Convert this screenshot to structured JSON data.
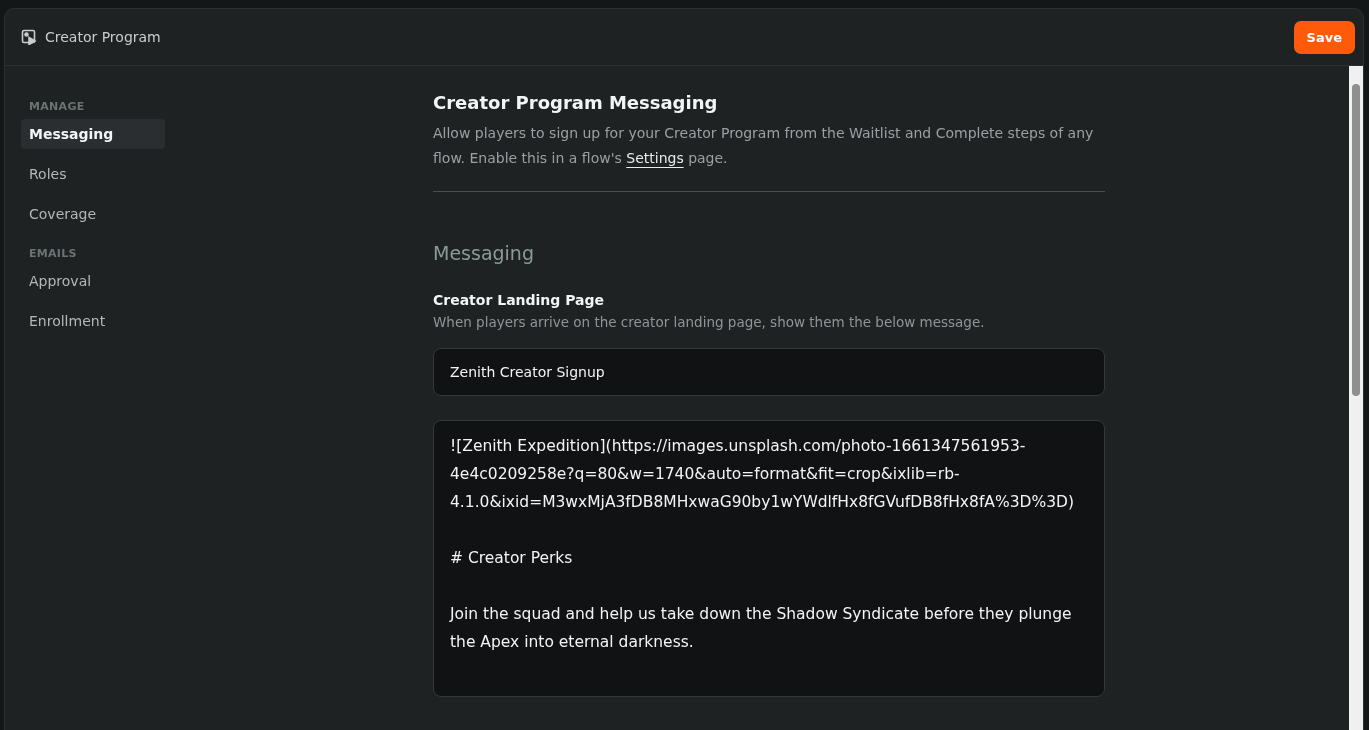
{
  "window": {
    "title": "Creator Program",
    "save_button": "Save"
  },
  "sidebar": {
    "sections": [
      {
        "heading": "MANAGE",
        "items": [
          {
            "label": "Messaging",
            "selected": true
          },
          {
            "label": "Roles",
            "selected": false
          },
          {
            "label": "Coverage",
            "selected": false
          }
        ]
      },
      {
        "heading": "EMAILS",
        "items": [
          {
            "label": "Approval",
            "selected": false
          },
          {
            "label": "Enrollment",
            "selected": false
          }
        ]
      }
    ]
  },
  "main": {
    "title": "Creator Program Messaging",
    "description_before": "Allow players to sign up for your Creator Program from the Waitlist and Complete steps of any flow. Enable this in a flow's",
    "description_link": "Settings",
    "description_after": "page.",
    "section_title": "Messaging",
    "field_label": "Creator Landing Page",
    "field_hint": "When players arrive on the creator landing page, show them the below message.",
    "title_value": "Zenith Creator Signup",
    "message_value": "![Zenith Expedition](https://images.unsplash.com/photo-1661347561953-4e4c0209258e?q=80&w=1740&auto=format&fit=crop&ixlib=rb-4.1.0&ixid=M3wxMjA3fDB8MHxwaG90by1wYWdlfHx8fGVufDB8fHx8fA%3D%3D)\n\n# Creator Perks\n\nJoin the squad and help us take down the Shadow Syndicate before they plunge the Apex into eternal darkness."
  }
}
